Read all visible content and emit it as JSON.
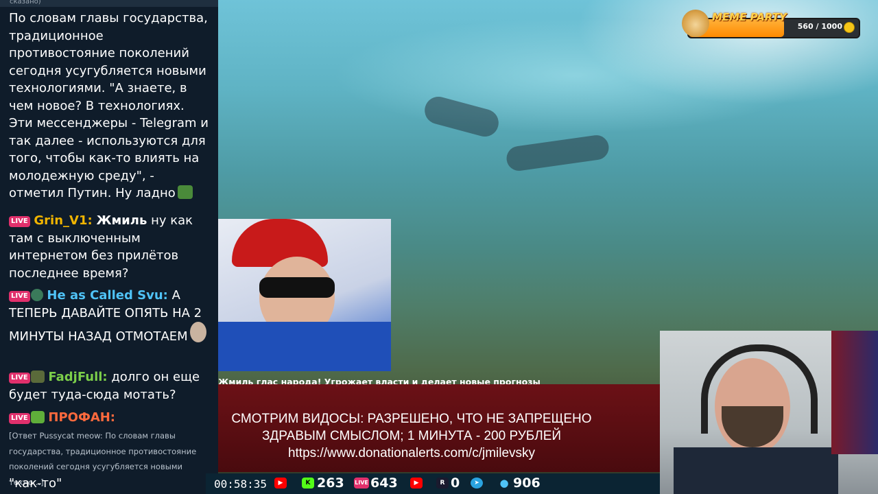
{
  "chat": {
    "header_snippet": "сказано)",
    "message1": "По словам главы государства, традиционное противостояние поколений сегодня усугубляется новыми технологиями. \"А знаете, в чем новое? В технологиях. Эти мессенджеры - Telegram и так далее - используются для того, чтобы как-то влиять на молодежную среду\", - отметил Путин. Ну ладно",
    "messages": [
      {
        "badge": "LIVE",
        "nick": "Grin_V1:",
        "nick_color": "#f0b400",
        "text_bold": "Жмиль",
        "text": " ну как там с выключенным интернетом без прилётов последнее время?"
      },
      {
        "badge": "LIVE",
        "nick": "He as Called Svu:",
        "nick_color": "#4fc3f7",
        "text": " А ТЕПЕРЬ ДАВАЙТЕ ОПЯТЬ НА 2 МИНУТЫ НАЗАД ОТМОТАЕМ"
      },
      {
        "badge": "LIVE",
        "nick": "FadjFull:",
        "nick_color": "#7ccf4a",
        "text": " долго он еще будет туда-сюда мотать?"
      },
      {
        "badge": "LIVE",
        "nick": "ПРОФАН:",
        "nick_color": "#ff6a3d",
        "text": ""
      }
    ],
    "reply": "[Ответ Pussycat meow: По словам главы государства, традиционное противостояние поколений сегодня усугубляется новыми техно...]",
    "last_line": "\"как-то\""
  },
  "video": {
    "title": "Жмиль глас народа! Угрожает власти и делает новые прогнозы"
  },
  "band": {
    "line1": "СМОТРИМ ВИДОСЫ: РАЗРЕШЕНО, ЧТО НЕ ЗАПРЕЩЕНО",
    "line2": "ЗДРАВЫМ СМЫСЛОМ; 1 МИНУТА - 200 РУБЛЕЙ",
    "line3": "https://www.donationalerts.com/c/jmilevsky"
  },
  "stats": {
    "timer": "00:58:35",
    "kick": "263",
    "live": "643",
    "rutube": "0",
    "viewers": "906",
    "live_badge": "LIVE",
    "r_badge": "R"
  },
  "meme_party": {
    "title": "MEME PARTY",
    "value": "560 / 1000",
    "progress_fraction": 0.56
  },
  "colors": {
    "live_badge": "#e1306c",
    "youtube": "#ff0000",
    "kick": "#53fc18",
    "telegram": "#2aa3e0",
    "viewers": "#4fc3f7"
  }
}
